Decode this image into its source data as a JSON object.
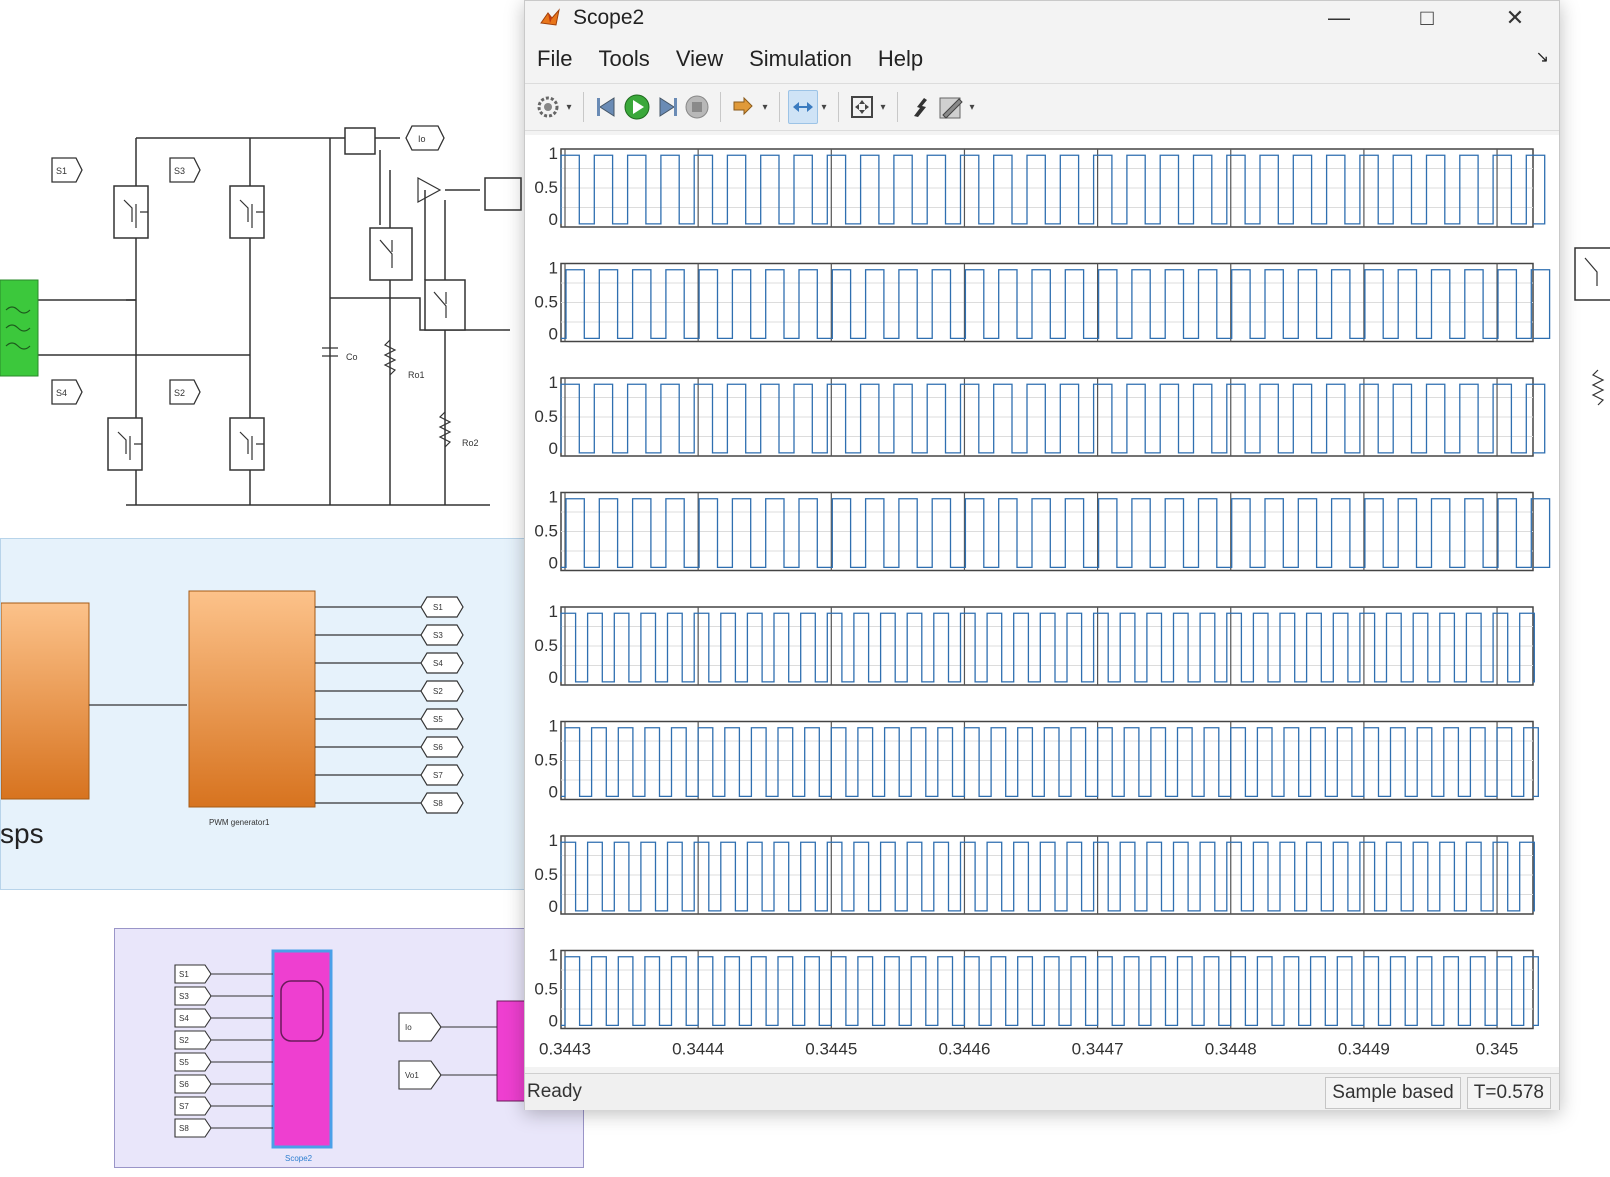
{
  "model": {
    "pwm_caption": "sps",
    "pwm_block_label": "PWM generator1",
    "scope_block_label": "Scope2",
    "pwm_outputs": [
      "S1",
      "S3",
      "S4",
      "S2",
      "S5",
      "S6",
      "S7",
      "S8"
    ],
    "gate_tags": [
      "S1",
      "S3",
      "S4",
      "S2"
    ],
    "scope_input_tags": [
      "S1",
      "S3",
      "S4",
      "S2",
      "S5",
      "S6",
      "S7",
      "S8"
    ],
    "extra_tags": [
      "Io",
      "Vo1"
    ],
    "component_labels": [
      "Co",
      "Ro1",
      "Ro2"
    ]
  },
  "window": {
    "title": "Scope2",
    "icon": "matlab-icon",
    "controls": [
      "minimize",
      "maximize",
      "close"
    ]
  },
  "menu": [
    "File",
    "Tools",
    "View",
    "Simulation",
    "Help"
  ],
  "toolbar": {
    "icons": [
      "settings-gear-icon",
      "step-back-icon",
      "run-icon",
      "step-forward-icon",
      "stop-icon",
      "highlight-icon",
      "zoom-axes-icon",
      "fit-view-icon",
      "cursor-measure-icon",
      "style-edit-icon"
    ],
    "active": "zoom-axes-icon"
  },
  "status": {
    "left": "Ready",
    "mode": "Sample based",
    "time": "T=0.578"
  },
  "chart_data": {
    "type": "line",
    "subplots": 8,
    "y_ticks": [
      "1",
      "0.5",
      "0"
    ],
    "ylim": [
      0,
      1
    ],
    "xlim": [
      0.3443,
      0.345
    ],
    "x_ticks": [
      "0.3443",
      "0.3444",
      "0.3445",
      "0.3446",
      "0.3447",
      "0.3448",
      "0.3449",
      "0.345"
    ],
    "line_color": "#2f6fb0",
    "grid": true,
    "series": [
      {
        "pulses_per_division": 4
      },
      {
        "pulses_per_division": 4
      },
      {
        "pulses_per_division": 4
      },
      {
        "pulses_per_division": 4
      },
      {
        "pulses_per_division": 5
      },
      {
        "pulses_per_division": 5
      },
      {
        "pulses_per_division": 5
      },
      {
        "pulses_per_division": 5
      }
    ]
  }
}
